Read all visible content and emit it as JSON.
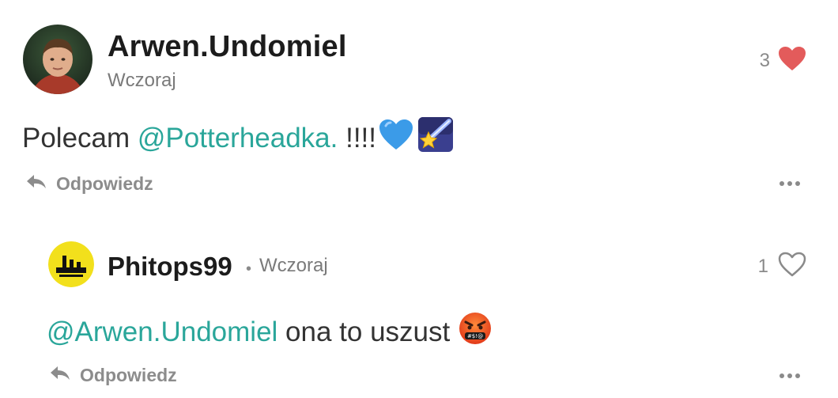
{
  "main_comment": {
    "username": "Arwen.Undomiel",
    "time": "Wczoraj",
    "like_count": "3",
    "liked": true,
    "text_prefix": "Polecam ",
    "mention": "@Potterheadka.",
    "text_suffix": " !!!!",
    "emojis": [
      "blue-heart",
      "shooting-star"
    ],
    "reply_label": "Odpowiedz"
  },
  "reply_comment": {
    "username": "Phitops99",
    "separator": "•",
    "time": "Wczoraj",
    "like_count": "1",
    "liked": false,
    "mention": "@Arwen.Undomiel",
    "text_suffix": " ona to uszust ",
    "emojis": [
      "cursing-face"
    ],
    "reply_label": "Odpowiedz"
  },
  "colors": {
    "mention": "#2aa69a",
    "heart_liked": "#e35b5b",
    "muted": "#8a8a8a"
  }
}
